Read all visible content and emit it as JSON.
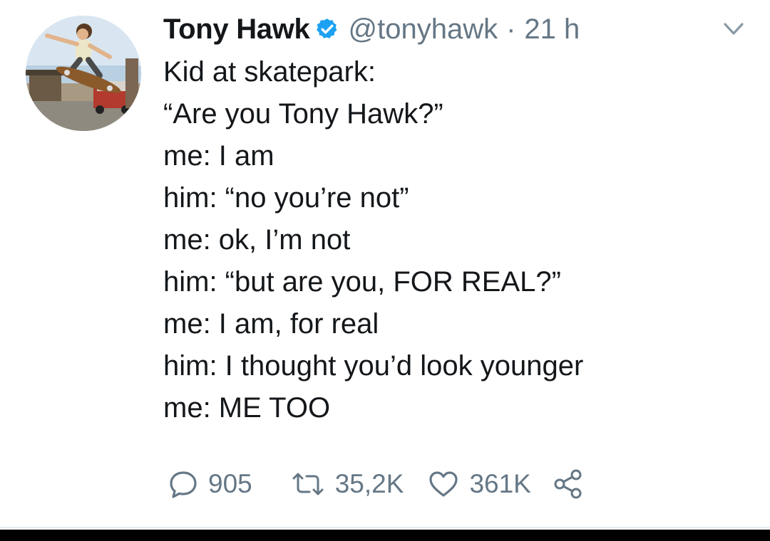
{
  "tweet": {
    "display_name": "Tony Hawk",
    "handle": "@tonyhawk",
    "separator": "·",
    "timestamp": "21 h",
    "verified": true,
    "lines": [
      "Kid at skatepark:",
      "“Are you Tony Hawk?”",
      "me: I am",
      "him: “no you’re not”",
      "me: ok, I’m not",
      "him: “but are you, FOR REAL?”",
      "me: I am, for real",
      "him: I thought you’d look younger",
      "me: ME TOO"
    ],
    "actions": {
      "reply_count": "905",
      "retweet_count": "35,2K",
      "like_count": "361K"
    }
  },
  "icons": {
    "verified": "verified-badge-icon",
    "caret": "chevron-down-icon",
    "reply": "reply-icon",
    "retweet": "retweet-icon",
    "like": "heart-icon",
    "share": "share-icon"
  },
  "colors": {
    "text": "#14171a",
    "secondary": "#657786",
    "verified": "#1da1f2"
  }
}
